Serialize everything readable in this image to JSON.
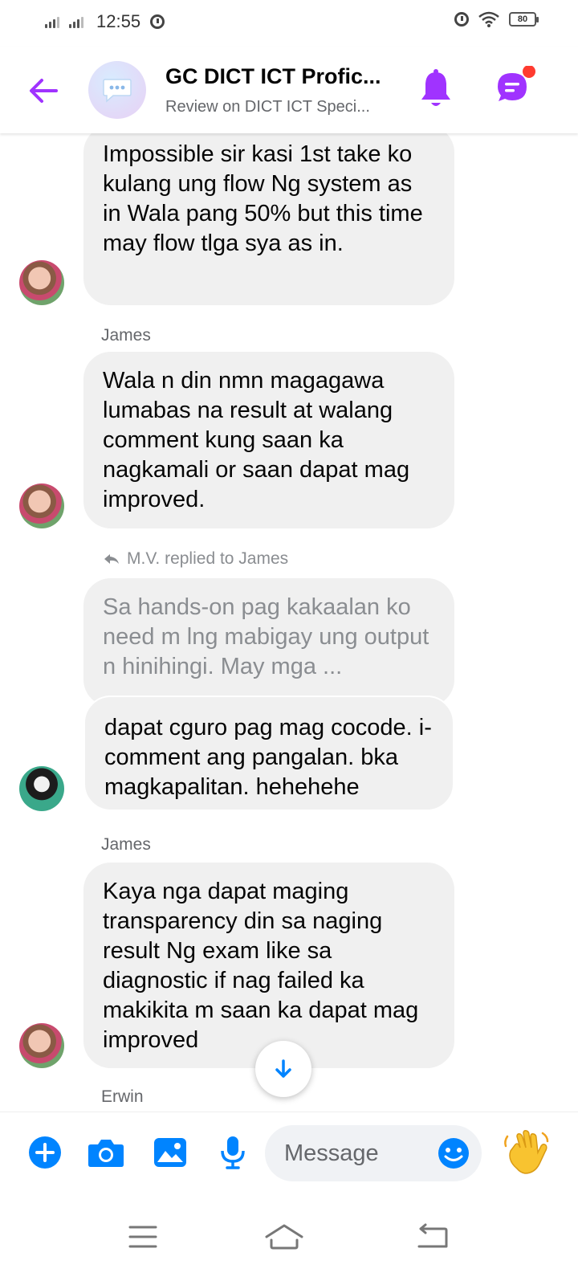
{
  "status_bar": {
    "time": "12:55",
    "battery": "80"
  },
  "header": {
    "title": "GC DICT ICT Profic...",
    "subtitle": "Review on DICT ICT Speci..."
  },
  "messages": [
    {
      "text": "Impossible sir kasi 1st take ko kulang ung flow Ng system as in Wala pang 50% but this time may flow tlga sya as in."
    },
    {
      "sender": "James",
      "text": "Wala n din nmn magagawa lumabas na result at walang comment kung saan ka nagkamali or saan dapat mag improved."
    },
    {
      "reply_label": "M.V. replied to James",
      "quoted": "Sa hands-on pag kakaalan ko need m lng mabigay ung output n hinihingi. May mga ...",
      "text": "dapat cguro pag mag cocode. i-comment ang pangalan. bka magkapalitan. hehehehe"
    },
    {
      "sender": "James",
      "text": "Kaya nga dapat maging transparency din sa naging result Ng exam like sa diagnostic if nag failed ka makikita m saan ka dapat mag improved"
    },
    {
      "sender": "Erwin"
    }
  ],
  "composer": {
    "placeholder": "Message"
  },
  "colors": {
    "accent": "#a033ff",
    "messenger_blue": "#0084ff",
    "bubble": "#f0f0f0",
    "badge": "#ff3b30"
  },
  "icons": [
    "back-arrow-icon",
    "chat-bubble-icon",
    "bell-icon",
    "chats-icon",
    "reply-arrow-icon",
    "arrow-down-icon",
    "plus-icon",
    "camera-icon",
    "image-icon",
    "microphone-icon",
    "emoji-icon",
    "waving-hand-icon",
    "menu-icon",
    "home-icon",
    "back-icon"
  ]
}
